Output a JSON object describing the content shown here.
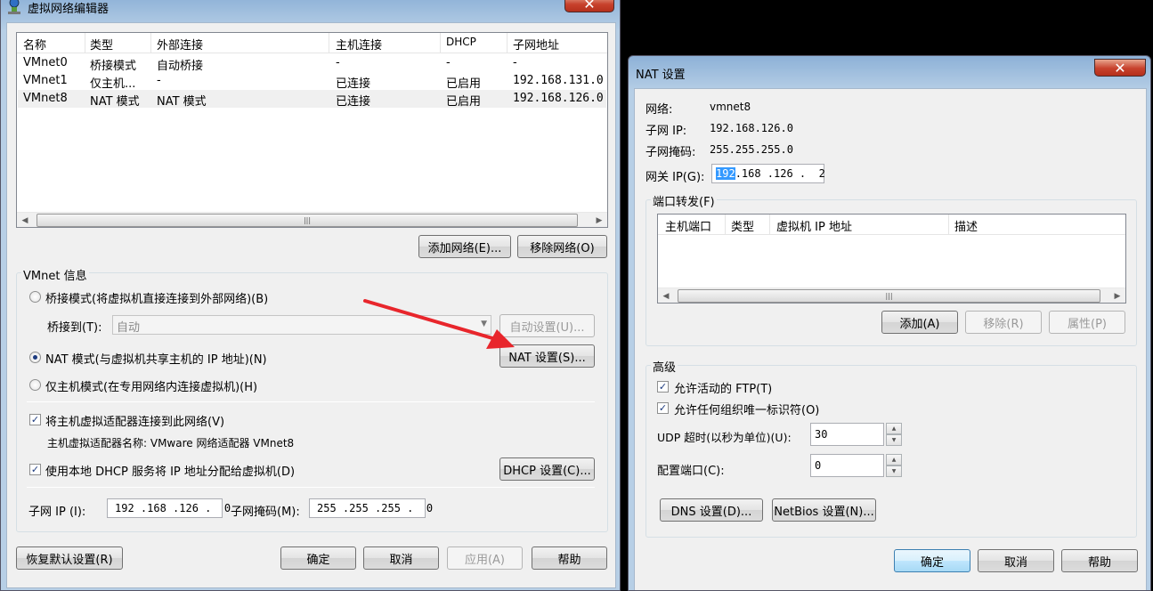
{
  "vne": {
    "title": "虚拟网络编辑器",
    "close": "✕",
    "columns": [
      "名称",
      "类型",
      "外部连接",
      "主机连接",
      "DHCP",
      "子网地址"
    ],
    "rows": [
      [
        "VMnet0",
        "桥接模式",
        "自动桥接",
        "-",
        "-",
        "-"
      ],
      [
        "VMnet1",
        "仅主机...",
        "-",
        "已连接",
        "已启用",
        "192.168.131.0"
      ],
      [
        "VMnet8",
        "NAT 模式",
        "NAT 模式",
        "已连接",
        "已启用",
        "192.168.126.0"
      ]
    ],
    "selected_row": 2,
    "add_network": "添加网络(E)...",
    "remove_network": "移除网络(O)",
    "info_group": "VMnet 信息",
    "bridge_mode": "桥接模式(将虚拟机直接连接到外部网络)(B)",
    "bridge_to_label": "桥接到(T):",
    "bridge_to_value": "自动",
    "auto_settings": "自动设置(U)...",
    "nat_mode": "NAT 模式(与虚拟机共享主机的 IP 地址)(N)",
    "nat_settings": "NAT 设置(S)...",
    "host_only": "仅主机模式(在专用网络内连接虚拟机)(H)",
    "connect_adapter": "将主机虚拟适配器连接到此网络(V)",
    "adapter_name": "主机虚拟适配器名称: VMware 网络适配器 VMnet8",
    "use_dhcp": "使用本地 DHCP 服务将 IP 地址分配给虚拟机(D)",
    "dhcp_settings": "DHCP 设置(C)...",
    "subnet_ip_label": "子网 IP (I):",
    "subnet_ip": "192 .168 .126 .  0",
    "subnet_mask_label": "子网掩码(M):",
    "subnet_mask": "255 .255 .255 .  0",
    "restore_defaults": "恢复默认设置(R)",
    "ok": "确定",
    "cancel": "取消",
    "apply": "应用(A)",
    "help": "帮助",
    "radio_selected": "nat",
    "connect_adapter_checked": true,
    "use_dhcp_checked": true
  },
  "nat": {
    "title": "NAT 设置",
    "close": "✕",
    "network_label": "网络:",
    "network_value": "vmnet8",
    "subnet_ip_label": "子网 IP:",
    "subnet_ip_value": "192.168.126.0",
    "subnet_mask_label": "子网掩码:",
    "subnet_mask_value": "255.255.255.0",
    "gateway_label": "网关 IP(G):",
    "gateway_first": "192",
    "gateway_rest": ".168 .126 .  2",
    "port_forward_group": "端口转发(F)",
    "pf_columns": [
      "主机端口",
      "类型",
      "虚拟机 IP 地址",
      "描述"
    ],
    "add": "添加(A)",
    "remove": "移除(R)",
    "properties": "属性(P)",
    "advanced_group": "高级",
    "allow_ftp": "允许活动的 FTP(T)",
    "allow_org_id": "允许任何组织唯一标识符(O)",
    "udp_timeout_label": "UDP 超时(以秒为单位)(U):",
    "udp_timeout_value": "30",
    "config_port_label": "配置端口(C):",
    "config_port_value": "0",
    "dns_settings": "DNS 设置(D)...",
    "netbios_settings": "NetBios 设置(N)...",
    "ok": "确定",
    "cancel": "取消",
    "help": "帮助",
    "allow_ftp_checked": true,
    "allow_org_id_checked": true
  },
  "colors": {
    "annotation_arrow": "#e8262c",
    "close_red": "#c7412c",
    "selection_blue": "#3399ff"
  }
}
